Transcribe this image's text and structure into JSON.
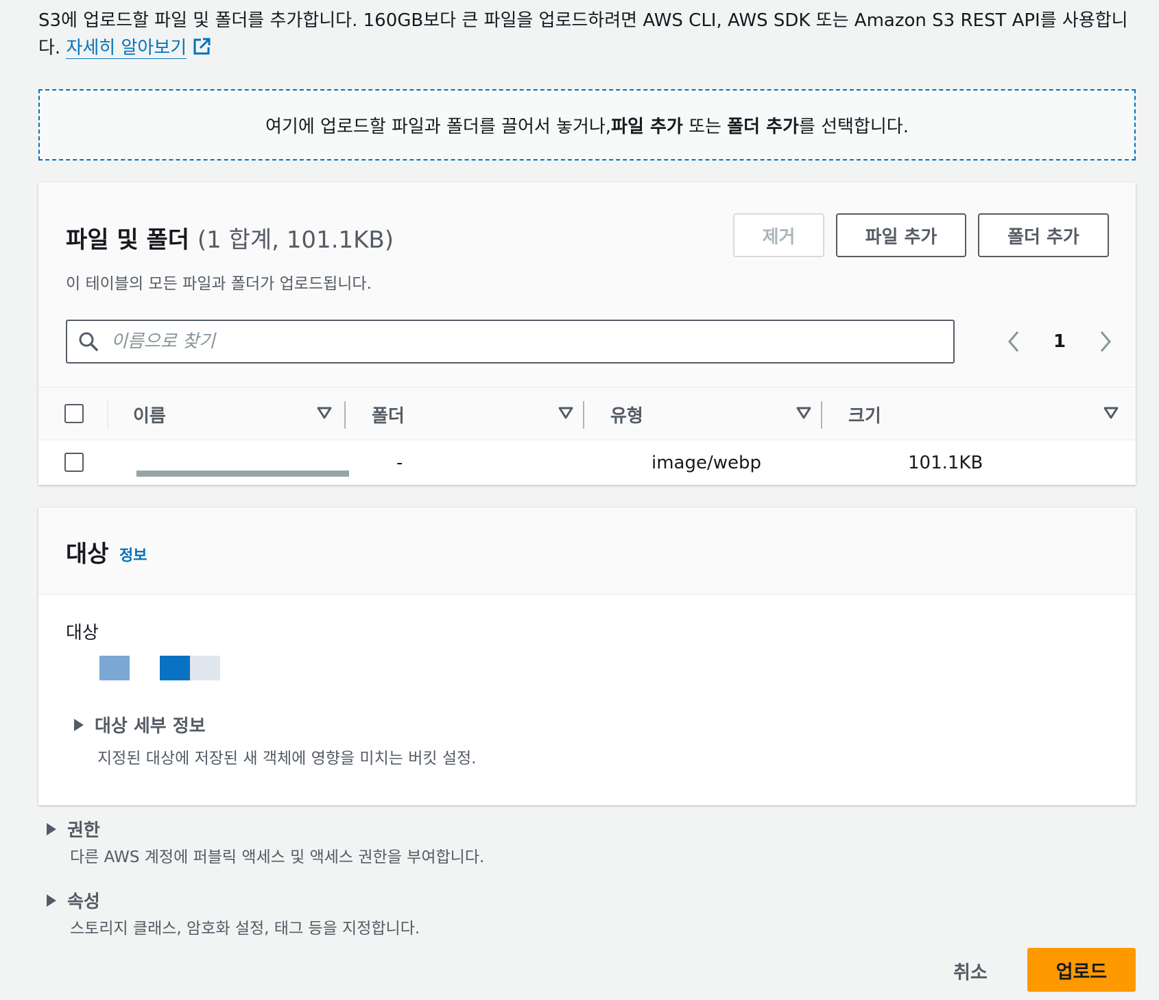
{
  "intro": {
    "text": "S3에 업로드할 파일 및 폴더를 추가합니다. 160GB보다 큰 파일을 업로드하려면 AWS CLI, AWS SDK 또는 Amazon S3 REST API를 사용합니다.",
    "learn_more": "자세히 알아보기"
  },
  "dropzone": {
    "prefix": "여기에 업로드할 파일과 폴더를 끌어서 놓거나, ",
    "add_files": "파일 추가",
    "middle": " 또는 ",
    "add_folder": "폴더 추가",
    "suffix": "를 선택합니다."
  },
  "files_panel": {
    "title": "파일 및 폴더",
    "count": "(1 합계, 101.1KB)",
    "description": "이 테이블의 모든 파일과 폴더가 업로드됩니다.",
    "remove_label": "제거",
    "add_files_label": "파일 추가",
    "add_folder_label": "폴더 추가",
    "search_placeholder": "이름으로 찾기",
    "page": "1",
    "columns": [
      "이름",
      "폴더",
      "유형",
      "크기"
    ],
    "rows": [
      {
        "name": "",
        "folder": "-",
        "type": "image/webp",
        "size": "101.1KB"
      }
    ]
  },
  "destination": {
    "title": "대상",
    "info": "정보",
    "field_label": "대상",
    "details_title": "대상 세부 정보",
    "details_desc": "지정된 대상에 저장된 새 객체에 영향을 미치는 버킷 설정."
  },
  "permissions": {
    "title": "권한",
    "desc": "다른 AWS 계정에 퍼블릭 액세스 및 액세스 권한을 부여합니다."
  },
  "properties": {
    "title": "속성",
    "desc": "스토리지 클래스, 암호화 설정, 태그 등을 지정합니다."
  },
  "footer": {
    "cancel": "취소",
    "upload": "업로드"
  },
  "colors": {
    "link": "#0073bb",
    "primary_button": "#ff9900",
    "border": "#545b64"
  }
}
